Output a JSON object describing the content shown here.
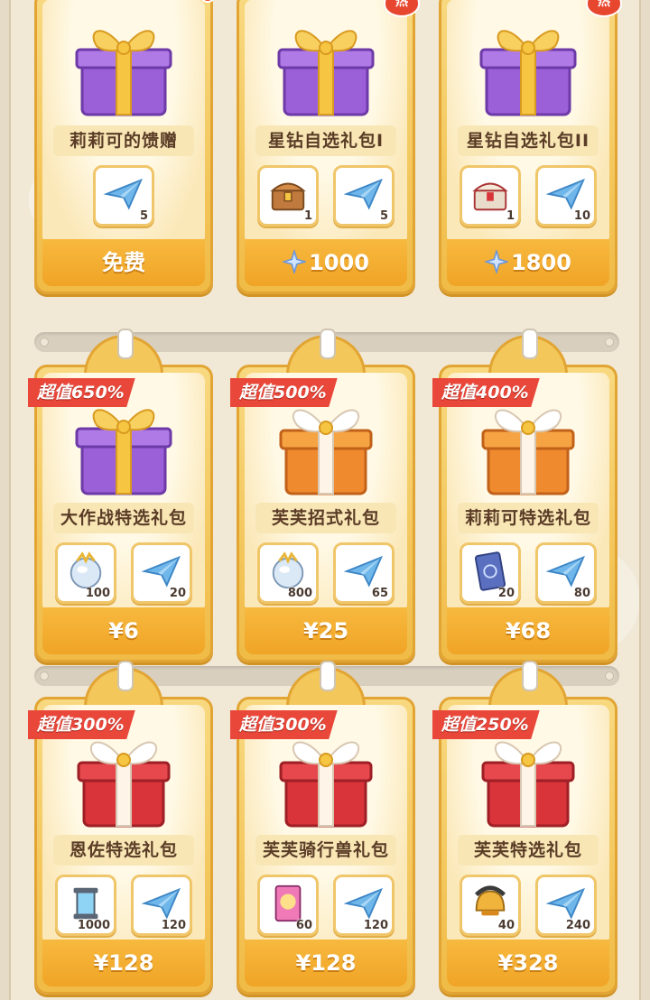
{
  "colors": {
    "card_gold": "#f0bb46",
    "price_orange": "#f0a426",
    "ribbon_red": "#e9473a"
  },
  "row1": [
    {
      "name": "莉莉可的馈赠",
      "items": [
        {
          "icon": "paper-plane-icon",
          "qty": "5"
        }
      ],
      "price": "免费",
      "price_icon": "",
      "badge": "dot"
    },
    {
      "name": "星钻自选礼包I",
      "items": [
        {
          "icon": "treasure-chest-icon",
          "qty": "1"
        },
        {
          "icon": "paper-plane-icon",
          "qty": "5"
        }
      ],
      "price": "1000",
      "price_icon": "star-diamond-icon",
      "badge": "热"
    },
    {
      "name": "星钻自选礼包II",
      "items": [
        {
          "icon": "royal-chest-icon",
          "qty": "1"
        },
        {
          "icon": "paper-plane-icon",
          "qty": "10"
        }
      ],
      "price": "1800",
      "price_icon": "star-diamond-icon",
      "badge": "热"
    }
  ],
  "row2": [
    {
      "tag": "超值650%",
      "name": "大作战特选礼包",
      "items": [
        {
          "icon": "crystal-orb-icon",
          "qty": "100"
        },
        {
          "icon": "paper-plane-icon",
          "qty": "20"
        }
      ],
      "price": "¥6"
    },
    {
      "tag": "超值500%",
      "name": "芙芙招式礼包",
      "items": [
        {
          "icon": "crystal-orb-icon",
          "qty": "800"
        },
        {
          "icon": "paper-plane-icon",
          "qty": "65"
        }
      ],
      "price": "¥25"
    },
    {
      "tag": "超值400%",
      "name": "莉莉可特选礼包",
      "items": [
        {
          "icon": "skill-card-icon",
          "qty": "20"
        },
        {
          "icon": "paper-plane-icon",
          "qty": "80"
        }
      ],
      "price": "¥68"
    }
  ],
  "row3": [
    {
      "tag": "超值300%",
      "name": "恩佐特选礼包",
      "items": [
        {
          "icon": "energy-capsule-icon",
          "qty": "1000"
        },
        {
          "icon": "paper-plane-icon",
          "qty": "120"
        }
      ],
      "price": "¥128"
    },
    {
      "tag": "超值300%",
      "name": "芙芙骑行兽礼包",
      "items": [
        {
          "icon": "mount-card-icon",
          "qty": "60"
        },
        {
          "icon": "paper-plane-icon",
          "qty": "120"
        }
      ],
      "price": "¥128"
    },
    {
      "tag": "超值250%",
      "name": "芙芙特选礼包",
      "items": [
        {
          "icon": "golden-helmet-icon",
          "qty": "40"
        },
        {
          "icon": "paper-plane-icon",
          "qty": "240"
        }
      ],
      "price": "¥328"
    }
  ]
}
